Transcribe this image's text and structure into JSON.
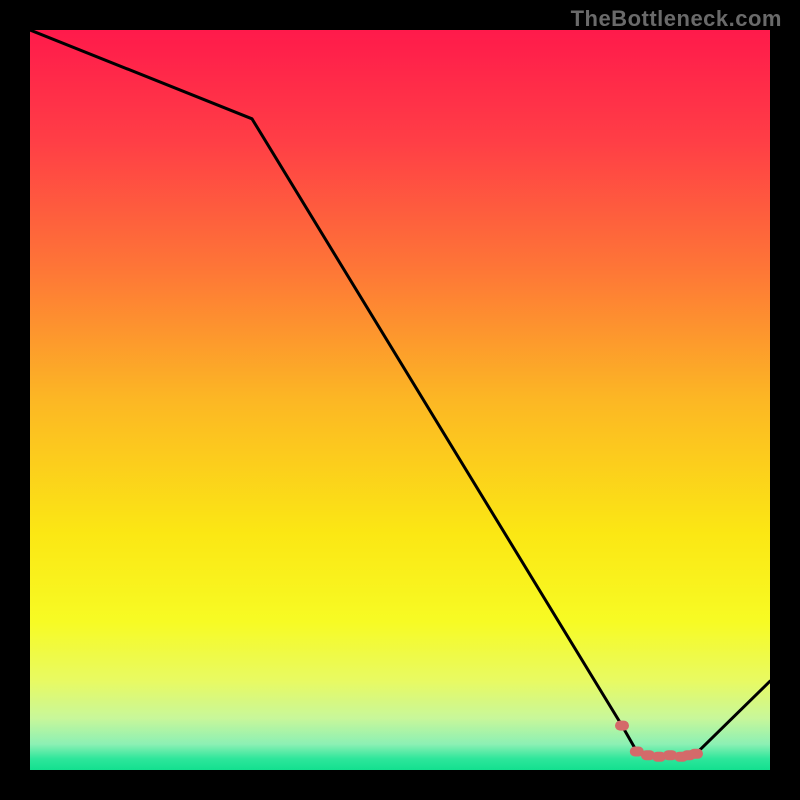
{
  "watermark": "TheBottleneck.com",
  "colors": {
    "background": "#000000",
    "line": "#000000",
    "marker": "#d46a6a",
    "gradient_stops": [
      {
        "offset": 0.0,
        "color": "#ff1a4b"
      },
      {
        "offset": 0.15,
        "color": "#ff3e46"
      },
      {
        "offset": 0.32,
        "color": "#fe7537"
      },
      {
        "offset": 0.5,
        "color": "#fcb724"
      },
      {
        "offset": 0.68,
        "color": "#fbe714"
      },
      {
        "offset": 0.8,
        "color": "#f7fb24"
      },
      {
        "offset": 0.88,
        "color": "#e8fa63"
      },
      {
        "offset": 0.93,
        "color": "#c8f79a"
      },
      {
        "offset": 0.965,
        "color": "#8cf0b4"
      },
      {
        "offset": 0.985,
        "color": "#2de69b"
      },
      {
        "offset": 1.0,
        "color": "#13e08f"
      }
    ]
  },
  "chart_data": {
    "type": "line",
    "title": "",
    "xlabel": "",
    "ylabel": "",
    "xlim": [
      0,
      100
    ],
    "ylim": [
      0,
      100
    ],
    "grid": false,
    "series": [
      {
        "name": "curve",
        "x": [
          0,
          30,
          80,
          82,
          83.5,
          85,
          86.5,
          88,
          89,
          90,
          100
        ],
        "y": [
          100,
          88,
          6,
          2.5,
          2,
          1.8,
          2,
          1.8,
          2,
          2.2,
          12
        ],
        "marker_x": [
          80,
          82,
          83.5,
          85,
          86.5,
          88,
          89,
          90
        ],
        "marker_y": [
          6,
          2.5,
          2,
          1.8,
          2,
          1.8,
          2,
          2.2
        ]
      }
    ]
  }
}
